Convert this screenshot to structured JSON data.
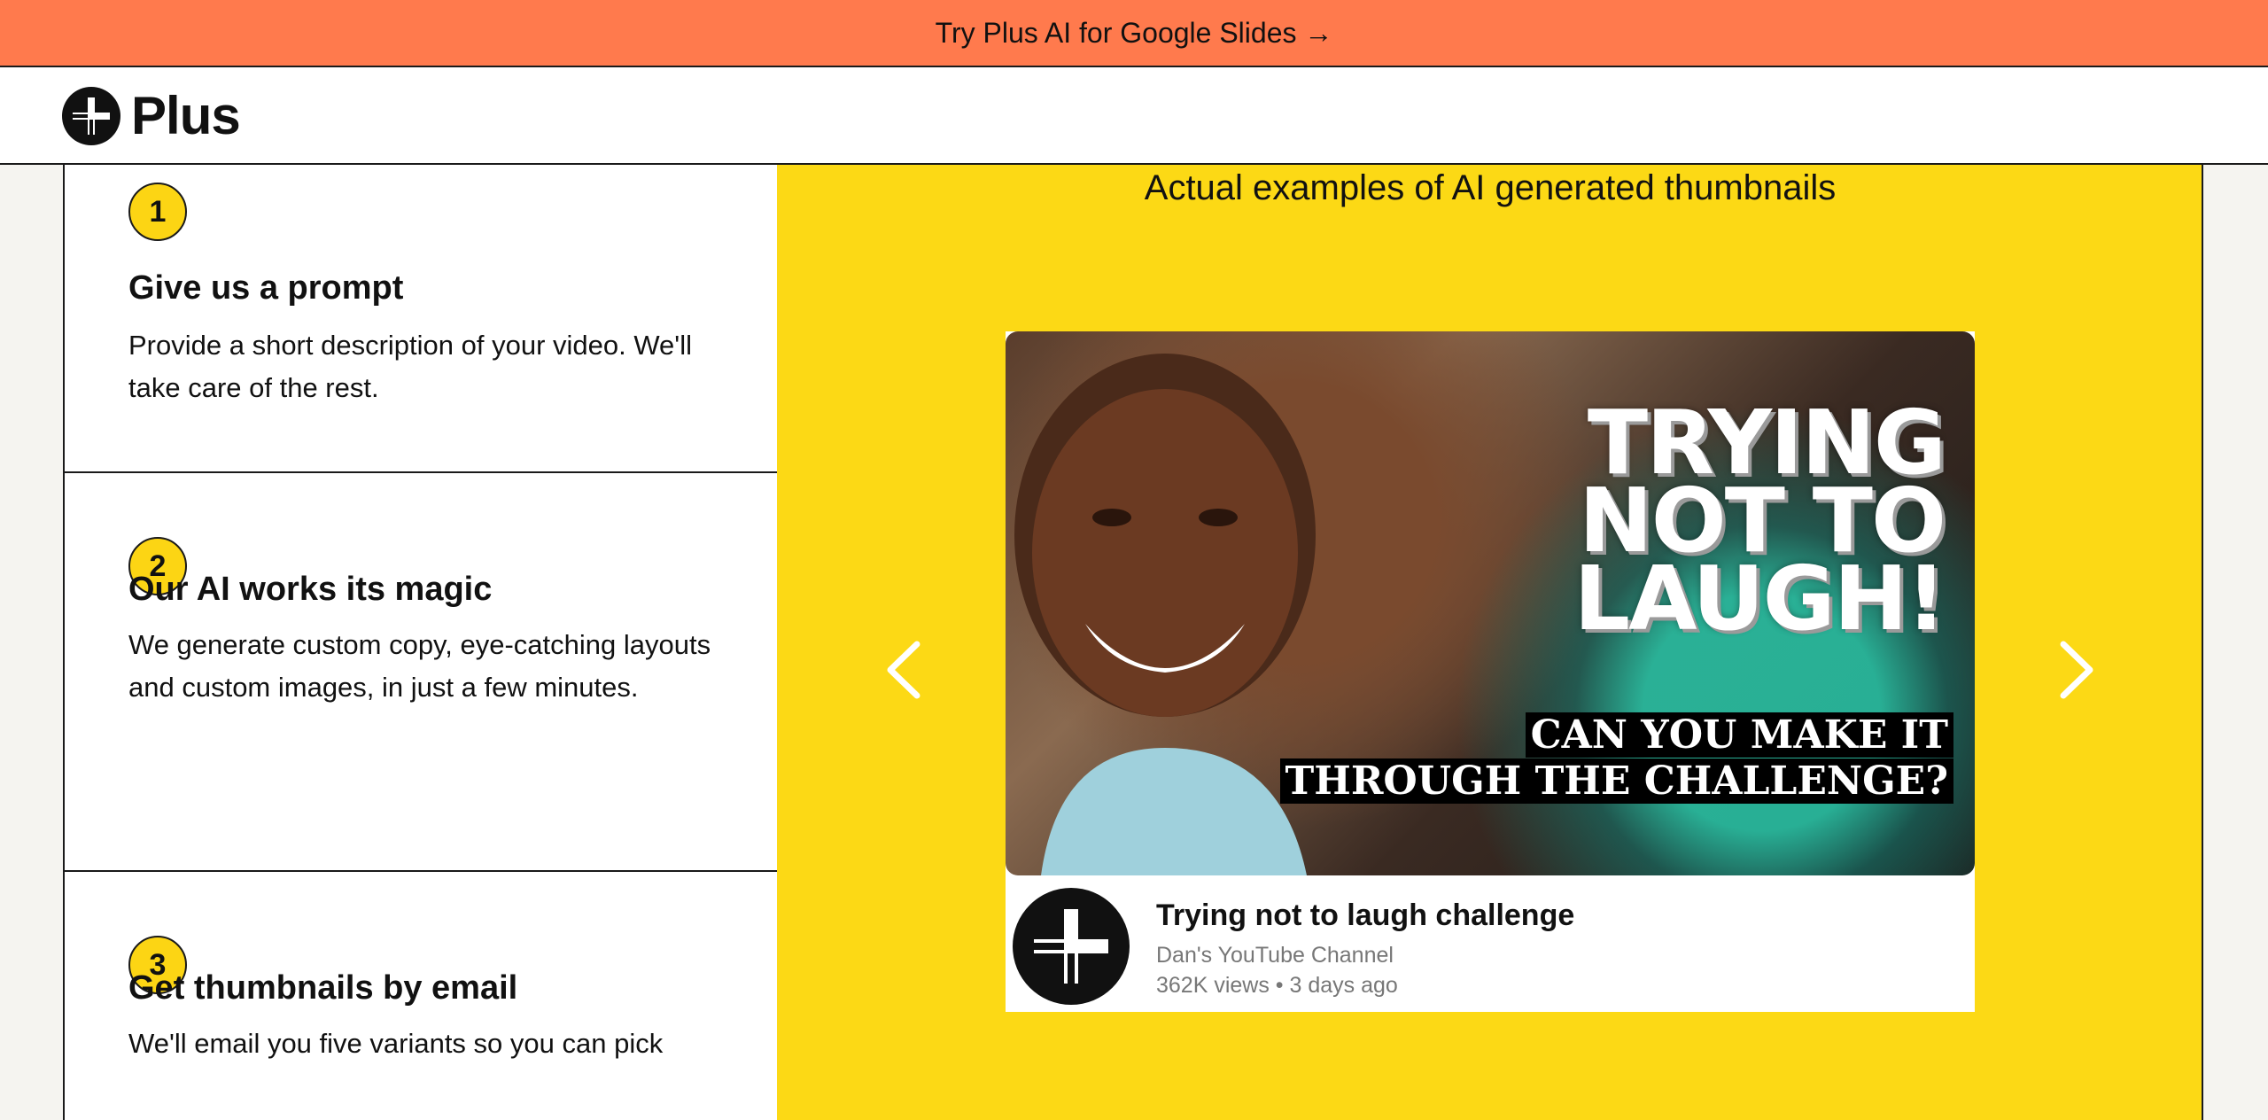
{
  "banner": {
    "text": "Try Plus AI for Google Slides →"
  },
  "header": {
    "logo_text": "Plus"
  },
  "steps": [
    {
      "number": "1",
      "title": "Give us a prompt",
      "description": "Provide a short description of your video. We'll take care of the rest."
    },
    {
      "number": "2",
      "title": "Our AI works its magic",
      "description": "We generate custom copy, eye-catching layouts and custom images, in just a few minutes."
    },
    {
      "number": "3",
      "title": "Get thumbnails by email",
      "description": "We'll email you five variants so you can pick"
    }
  ],
  "showcase": {
    "title": "Actual examples of AI generated thumbnails",
    "thumbnail_headline": "TRYING NOT TO LAUGH!",
    "thumbnail_subline_1": "CAN YOU MAKE IT",
    "thumbnail_subline_2": "THROUGH THE CHALLENGE?",
    "video_title": "Trying not to laugh challenge",
    "channel": "Dan's YouTube Channel",
    "meta": "362K views • 3 days ago",
    "prev_icon": "chevron-left-icon",
    "next_icon": "chevron-right-icon"
  },
  "colors": {
    "banner": "#ff7a4d",
    "accent_yellow": "#fcd915",
    "border": "#1a1a1a"
  }
}
